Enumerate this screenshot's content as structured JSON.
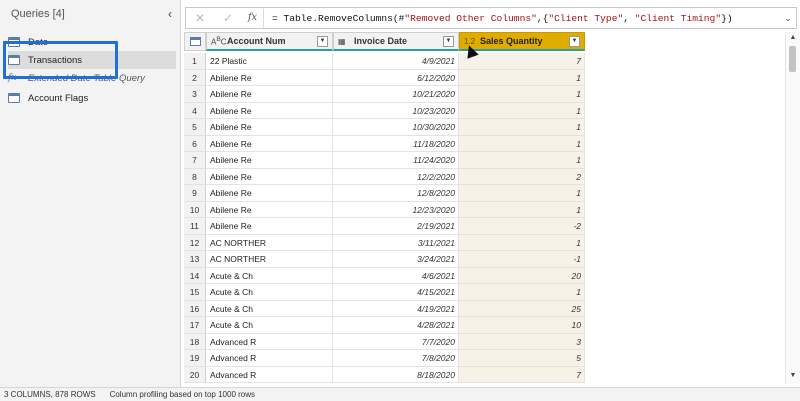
{
  "queries": {
    "header": "Queries [4]",
    "items": [
      {
        "label": "Date",
        "type": "table"
      },
      {
        "label": "Transactions",
        "type": "table"
      },
      {
        "label": "Extended Date Table Query",
        "type": "function"
      },
      {
        "label": "Account Flags",
        "type": "table"
      }
    ]
  },
  "formula": {
    "fx": "fx",
    "prefix": "= Table.RemoveColumns(#",
    "arg1": "\"Removed Other Columns\"",
    "mid": ",{",
    "arg2": "\"Client Type\"",
    "sep": ", ",
    "arg3": "\"Client Timing\"",
    "suffix": "})"
  },
  "grid": {
    "columns": [
      {
        "label": "Account Num",
        "type_icon": "ABC"
      },
      {
        "label": "Invoice Date",
        "type_icon": "calendar"
      },
      {
        "label": "Sales Quantity",
        "type_icon": "1.2"
      }
    ],
    "rows": [
      [
        "22 Plastic",
        "4/9/2021",
        "7"
      ],
      [
        "Abilene Re",
        "6/12/2020",
        "1"
      ],
      [
        "Abilene Re",
        "10/21/2020",
        "1"
      ],
      [
        "Abilene Re",
        "10/23/2020",
        "1"
      ],
      [
        "Abilene Re",
        "10/30/2020",
        "1"
      ],
      [
        "Abilene Re",
        "11/18/2020",
        "1"
      ],
      [
        "Abilene Re",
        "11/24/2020",
        "1"
      ],
      [
        "Abilene Re",
        "12/2/2020",
        "2"
      ],
      [
        "Abilene Re",
        "12/8/2020",
        "1"
      ],
      [
        "Abilene Re",
        "12/23/2020",
        "1"
      ],
      [
        "Abilene Re",
        "2/19/2021",
        "-2"
      ],
      [
        "AC NORTHER",
        "3/11/2021",
        "1"
      ],
      [
        "AC NORTHER",
        "3/24/2021",
        "-1"
      ],
      [
        "Acute & Ch",
        "4/6/2021",
        "20"
      ],
      [
        "Acute & Ch",
        "4/15/2021",
        "1"
      ],
      [
        "Acute & Ch",
        "4/19/2021",
        "25"
      ],
      [
        "Acute & Ch",
        "4/28/2021",
        "10"
      ],
      [
        "Advanced R",
        "7/7/2020",
        "3"
      ],
      [
        "Advanced R",
        "7/8/2020",
        "5"
      ],
      [
        "Advanced R",
        "8/18/2020",
        "7"
      ]
    ]
  },
  "status": {
    "columns_rows": "3 COLUMNS, 878 ROWS",
    "profiling": "Column profiling based on top 1000 rows"
  },
  "colors": {
    "selected_header": "#e0ac00",
    "highlight_box": "#1e6fd9",
    "quality_bar": "#2aa198"
  }
}
